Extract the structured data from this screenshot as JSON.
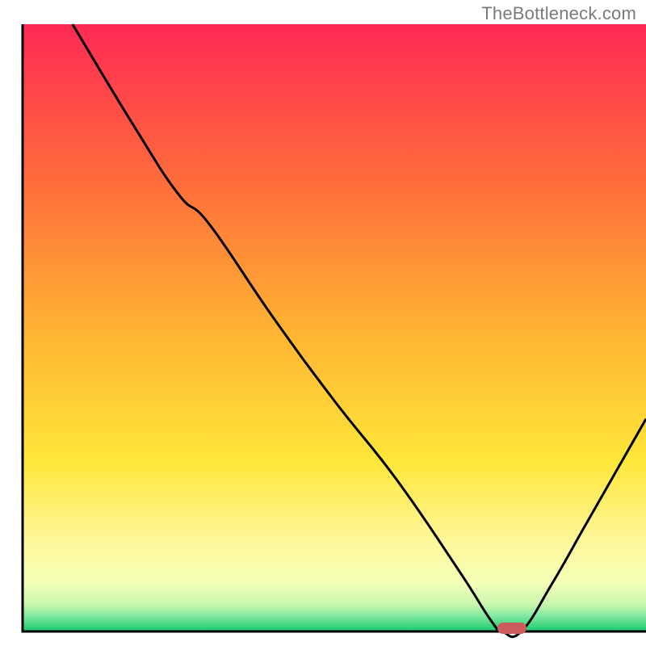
{
  "watermark": "TheBottleneck.com",
  "chart_data": {
    "type": "line",
    "title": "",
    "xlabel": "",
    "ylabel": "",
    "xlim": [
      0,
      100
    ],
    "ylim": [
      0,
      100
    ],
    "note": "Axes carry no tick labels; x and y are normalized 0–100. Optimum (valley) at roughly x≈77–80 where curve touches y≈0.",
    "series": [
      {
        "name": "bottleneck-curve",
        "x": [
          8,
          18,
          25,
          30,
          40,
          50,
          60,
          70,
          75,
          77,
          80,
          85,
          90,
          95,
          100
        ],
        "y": [
          100,
          83,
          72,
          67,
          52,
          38,
          25,
          10,
          2,
          0,
          0,
          8,
          17,
          26,
          35
        ]
      }
    ],
    "marker": {
      "name": "optimum-marker",
      "x": 78.5,
      "y": 0,
      "color": "#cc5b5b"
    },
    "gradient_stops": [
      {
        "offset": 0.0,
        "color": "#ff2a55"
      },
      {
        "offset": 0.25,
        "color": "#ff6a3c"
      },
      {
        "offset": 0.5,
        "color": "#ffb233"
      },
      {
        "offset": 0.72,
        "color": "#ffe73a"
      },
      {
        "offset": 0.85,
        "color": "#fff79a"
      },
      {
        "offset": 0.92,
        "color": "#f4ffb8"
      },
      {
        "offset": 0.955,
        "color": "#c9f7ac"
      },
      {
        "offset": 0.975,
        "color": "#7fe8a0"
      },
      {
        "offset": 1.0,
        "color": "#18c96b"
      }
    ]
  }
}
